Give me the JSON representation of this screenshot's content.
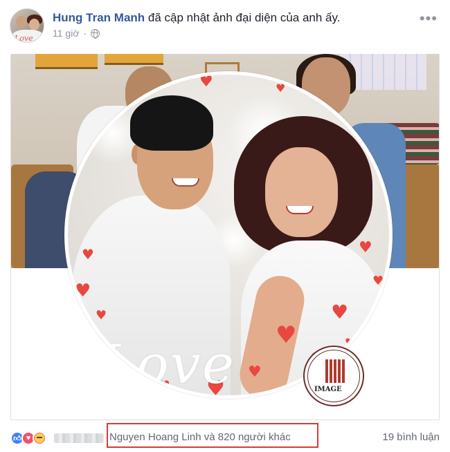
{
  "post": {
    "author": "Hung Tran Manh",
    "action": " đã cập nhật ảnh đại diện của anh ấy.",
    "time": "11 giờ",
    "more_icon": "ellipsis-icon",
    "privacy_icon": "globe-icon"
  },
  "photo": {
    "caption_art": "Love",
    "stamp_text": "IMAGE"
  },
  "footer": {
    "reactions": [
      "like",
      "love",
      "angry"
    ],
    "likers": "Nguyen Hoang Linh và 820 người khác",
    "comments": "19 bình luận",
    "highlight_color": "#d93a34"
  }
}
